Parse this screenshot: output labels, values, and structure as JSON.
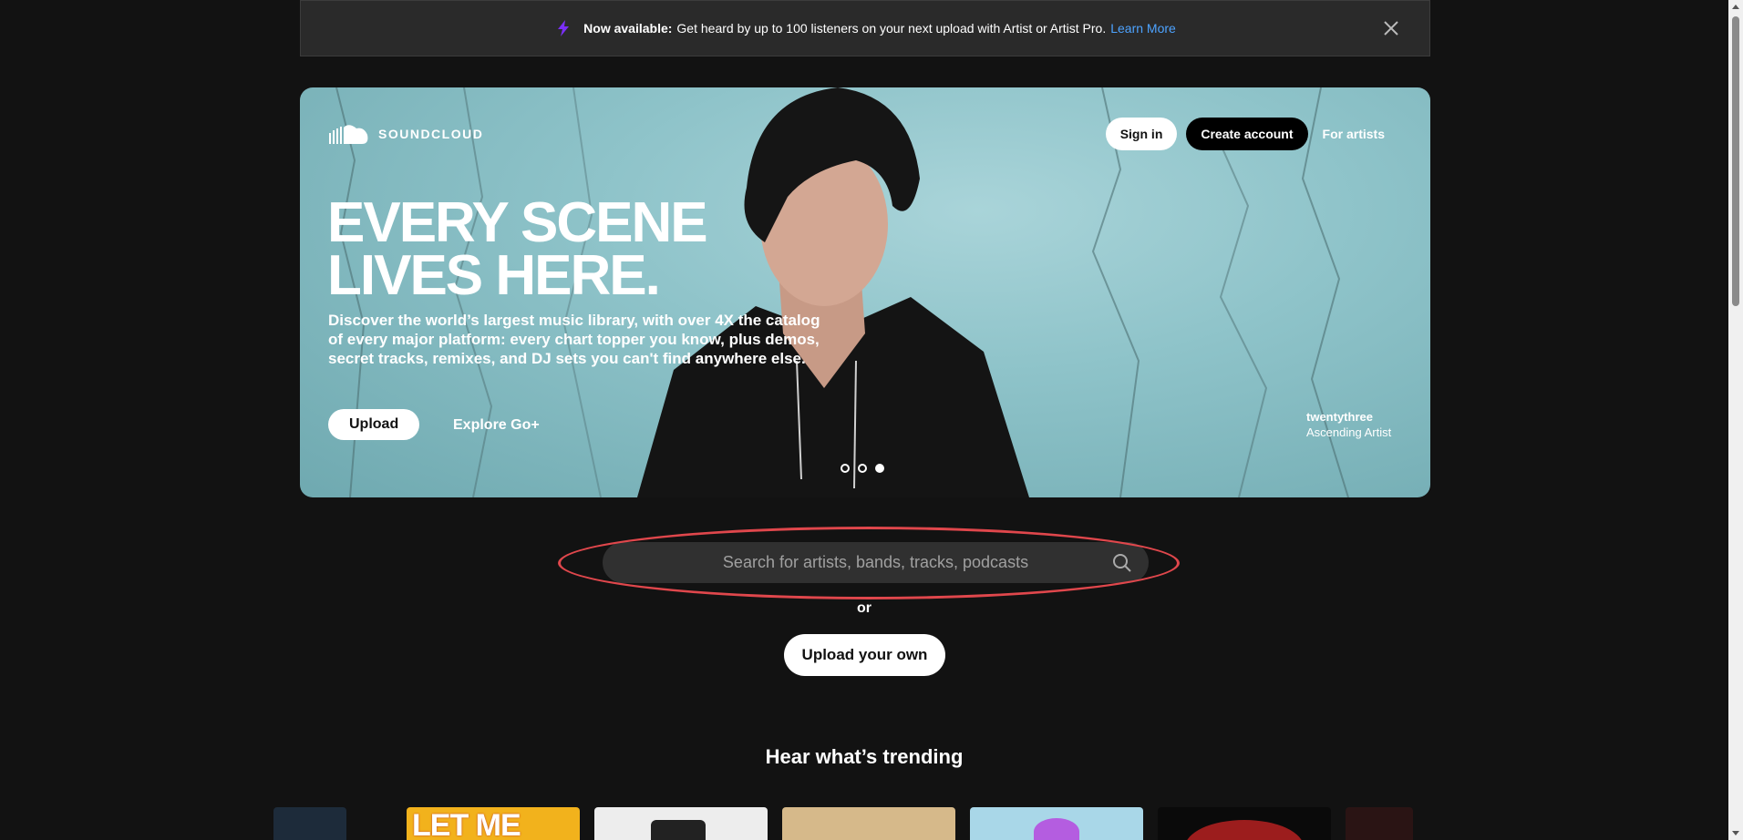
{
  "banner": {
    "bold": "Now available:",
    "text": "Get heard by up to 100 listeners on your next upload with Artist or Artist Pro.",
    "link": "Learn More",
    "icon": "lightning-bolt-icon",
    "close_icon": "close-icon"
  },
  "hero": {
    "logo_text": "SOUNDCLOUD",
    "nav": {
      "sign_in": "Sign in",
      "create_account": "Create account",
      "for_artists": "For artists"
    },
    "headline": "EVERY SCENE LIVES HERE.",
    "subtitle": "Discover the world’s largest music library, with over 4X the catalog of every major platform: every chart topper you know, plus demos, secret tracks, remixes, and DJ sets you can't find anywhere else.",
    "upload": "Upload",
    "explore": "Explore Go+",
    "credit_name": "twentythree",
    "credit_role": "Ascending Artist",
    "slides": [
      {
        "active": false
      },
      {
        "active": false
      },
      {
        "active": true
      }
    ]
  },
  "search": {
    "placeholder": "Search for artists, bands, tracks, podcasts"
  },
  "or_text": "or",
  "upload_own": "Upload your own",
  "trending": {
    "title": "Hear what’s trending",
    "cards": [
      {
        "color": "#1d2b3a"
      },
      {
        "color": "#f2b21c",
        "text": "LET ME DOWN"
      },
      {
        "color": "#ededed"
      },
      {
        "color": "#d6b98a"
      },
      {
        "color": "#a9d7e8"
      },
      {
        "color": "#0a0a0a"
      },
      {
        "color": "#2a1414"
      }
    ]
  },
  "colors": {
    "background": "#121212",
    "accent_link": "#4da3ff",
    "highlight_ring": "#e0474c",
    "bolt": "#7b2ff7"
  }
}
